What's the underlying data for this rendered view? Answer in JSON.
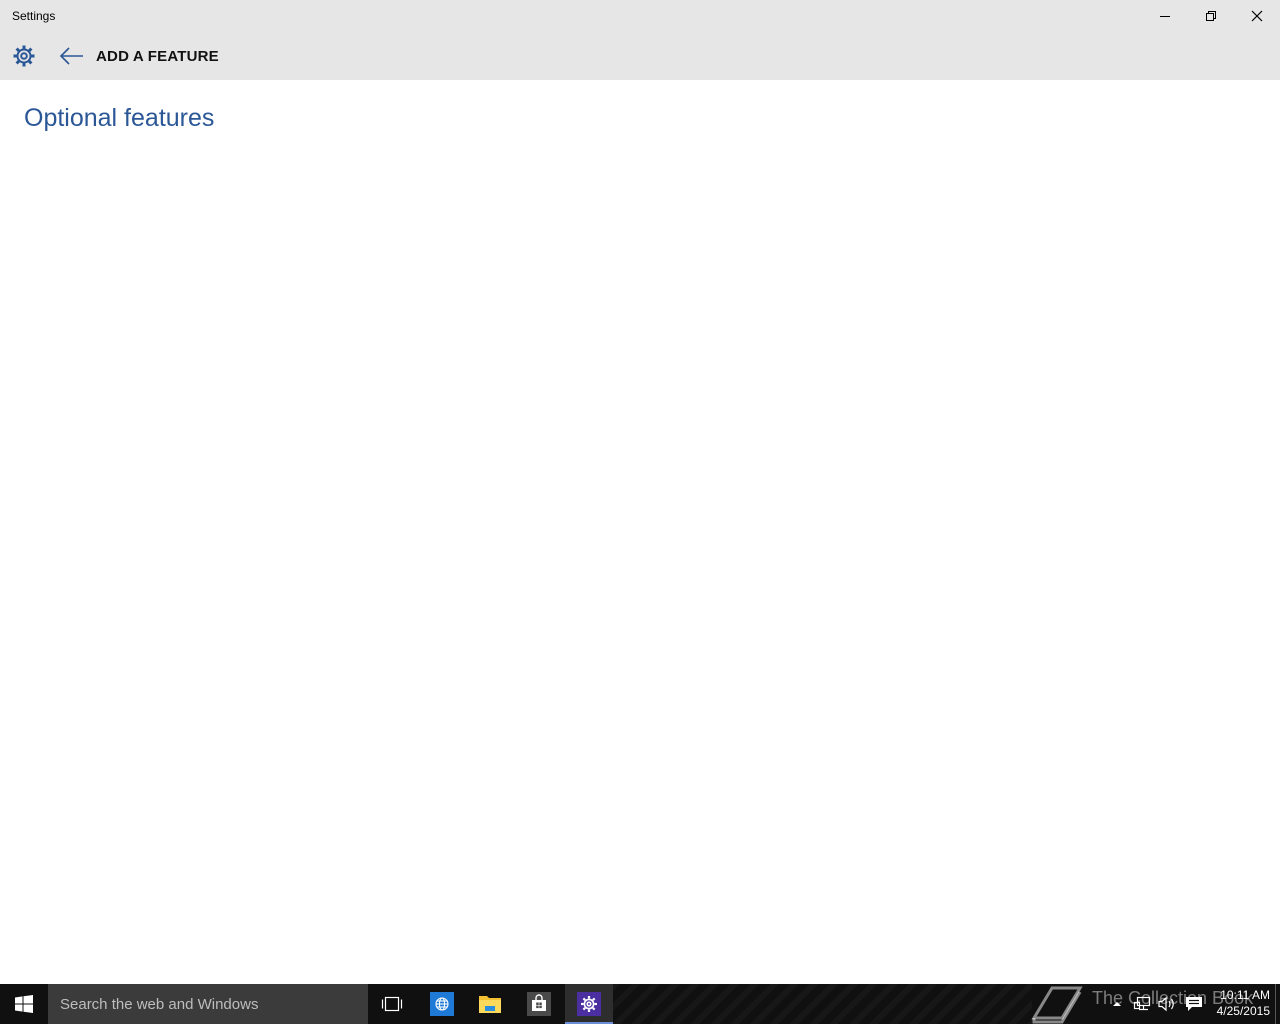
{
  "window": {
    "title": "Settings",
    "controls": [
      "minimize",
      "restore",
      "close"
    ]
  },
  "header": {
    "heading": "ADD A FEATURE",
    "icons": [
      "gear-icon",
      "back-arrow-icon"
    ]
  },
  "main": {
    "page_title": "Optional features"
  },
  "taskbar": {
    "search_placeholder": "Search the web and Windows",
    "apps": [
      "task-view",
      "internet-explorer",
      "file-explorer",
      "store",
      "settings"
    ],
    "active_app": "settings",
    "watermark_text": "The Collection Book",
    "clock": {
      "time": "10:11 AM",
      "date": "4/25/2015"
    }
  },
  "colors": {
    "title_blue": "#2b5797",
    "chrome_gray": "#e6e6e6",
    "taskbar": "#101010",
    "active_underline": "#6a8fd8"
  }
}
